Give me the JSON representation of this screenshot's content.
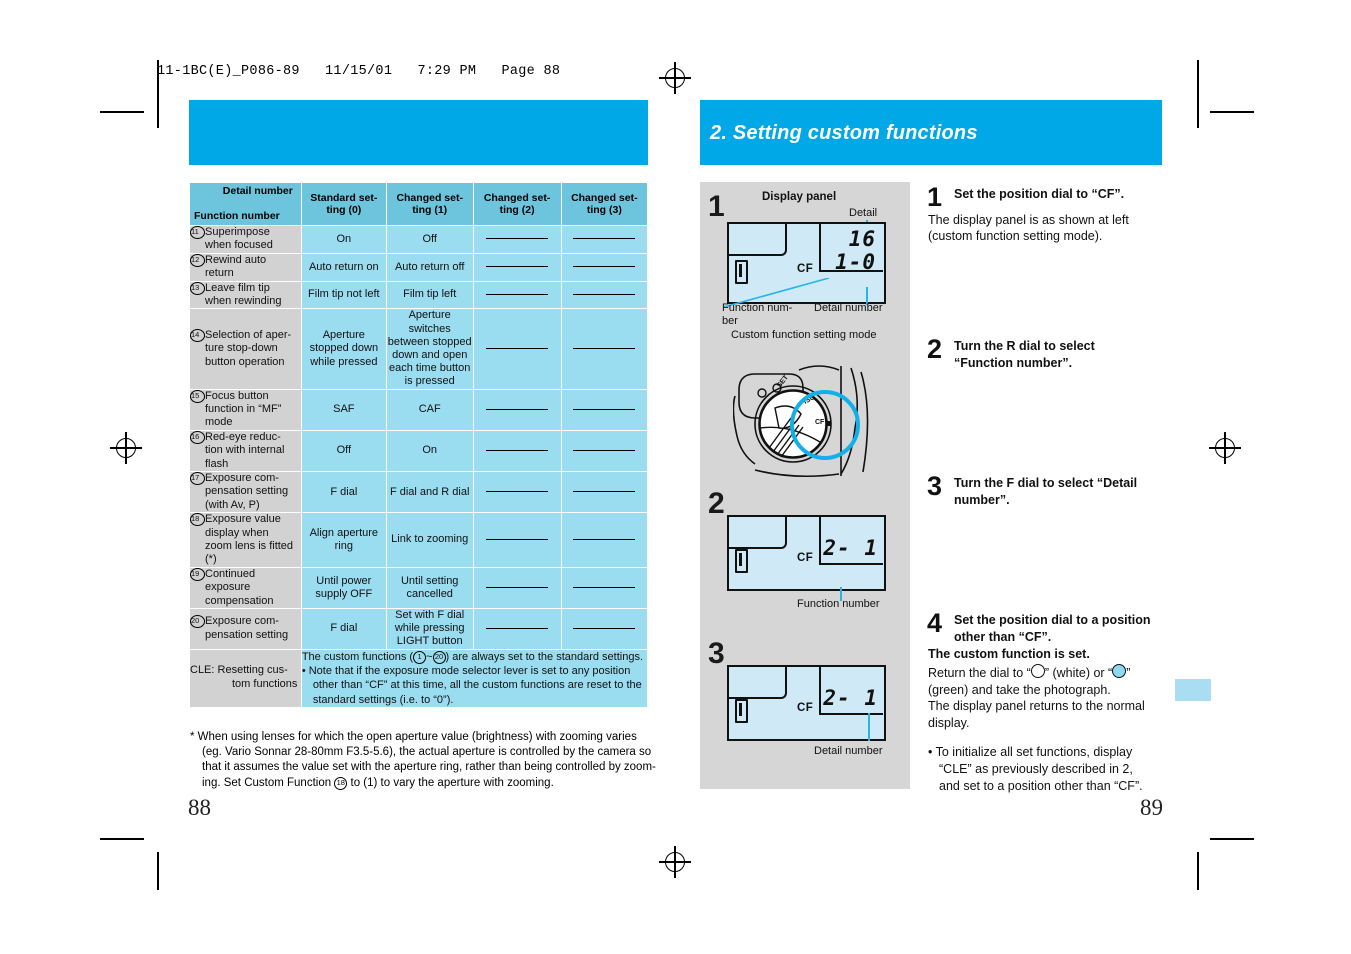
{
  "document": {
    "slug": "11-1BC(E)_P086-89   11/15/01   7:29 PM   Page 88",
    "section_title": "2. Setting custom functions",
    "page_left": "88",
    "page_right": "89",
    "accent_color": "#00a8e8",
    "table_header_color": "#6cc5dd",
    "table_value_color": "#9adcf0",
    "table_label_color": "#d2d2d2"
  },
  "table": {
    "corner": {
      "top_right_label": "Detail number",
      "bottom_left_label": "Function number"
    },
    "columns": [
      "Standard set-\nting (0)",
      "Changed set-\nting (1)",
      "Changed set-\nting (2)",
      "Changed set-\nting (3)"
    ],
    "columns_split": [
      {
        "l1": "Standard set-",
        "l2": "ting (0)"
      },
      {
        "l1": "Changed set-",
        "l2": "ting (1)"
      },
      {
        "l1": "Changed set-",
        "l2": "ting (2)"
      },
      {
        "l1": "Changed set-",
        "l2": "ting (3)"
      }
    ],
    "rows": [
      {
        "num": "11",
        "name": "Superimpose when focused",
        "c0": "On",
        "c1": "Off",
        "c2": "",
        "c3": ""
      },
      {
        "num": "12",
        "name": "Rewind auto return",
        "c0": "Auto return on",
        "c1": "Auto return off",
        "c2": "",
        "c3": ""
      },
      {
        "num": "13",
        "name": "Leave film tip when rewinding",
        "c0": "Film tip not left",
        "c1": "Film tip left",
        "c2": "",
        "c3": ""
      },
      {
        "num": "14",
        "name": "Selection of aper-ture stop-down button operation",
        "c0": "Aperture stopped down while pressed",
        "c1": "Aperture switches between stopped down and open each time button is pressed",
        "c2": "",
        "c3": ""
      },
      {
        "num": "15",
        "name": "Focus button function in “MF” mode",
        "c0": "SAF",
        "c1": "CAF",
        "c2": "",
        "c3": ""
      },
      {
        "num": "16",
        "name": "Red-eye reduc-tion with internal flash",
        "c0": "Off",
        "c1": "On",
        "c2": "",
        "c3": ""
      },
      {
        "num": "17",
        "name": "Exposure com-pensation setting (with Av, P)",
        "c0": "F dial",
        "c1": "F dial and R dial",
        "c2": "",
        "c3": ""
      },
      {
        "num": "18",
        "name": "Exposure value display when zoom lens is fitted (*)",
        "c0": "Align aperture ring",
        "c1": "Link to zooming",
        "c2": "",
        "c3": ""
      },
      {
        "num": "19",
        "name": "Continued exposure compensation",
        "c0": "Until power supply OFF",
        "c1": "Until setting cancelled",
        "c2": "",
        "c3": ""
      },
      {
        "num": "20",
        "name": "Exposure com-pensation setting",
        "c0": "F dial",
        "c1": "Set with F dial while pressing LIGHT button",
        "c2": "",
        "c3": ""
      }
    ],
    "cle_row": {
      "label_line1": "CLE: Resetting cus-",
      "label_line2": "tom functions",
      "text_line1_a": "The custom functions (",
      "text_line1_num1": "1",
      "text_line1_mid": "~",
      "text_line1_num2": "20",
      "text_line1_b": ") are always set to the standard settings.",
      "bullet": "Note that if the exposure mode selector lever is set to any position other than “CF” at this time, all the custom functions are reset to the standard settings (i.e. to “0”)."
    }
  },
  "footnote": {
    "line1": "* When using lenses for which the open aperture value (brightness) with zooming varies",
    "line2": "(eg. Vario Sonnar 28-80mm F3.5-5.6), the actual aperture is controlled by the camera so",
    "line3": "that it assumes the value set with the aperture ring, rather than being controlled by zoom-",
    "line4_a": "ing. Set Custom Function ",
    "line4_num": "18",
    "line4_b": " to (1) to vary the aperture with zooming."
  },
  "illustrations": {
    "panel1": {
      "step": "1",
      "title": "Display panel",
      "label_detail": "Detail",
      "label_function_number_l1": "Function num-",
      "label_function_number_l2": "ber",
      "label_detail_number": "Detail number",
      "caption": "Custom function setting mode",
      "lcd_cf": "CF",
      "lcd_top": "16",
      "lcd_bottom": "1-0"
    },
    "camera": {
      "dial_marks": [
        "SET",
        "ISO",
        "CF"
      ],
      "dial_circles": [
        "white-circle",
        "green-circle"
      ]
    },
    "panel2": {
      "step": "2",
      "lcd_cf": "CF",
      "lcd_value": "2- 1",
      "label": "Function number"
    },
    "panel3": {
      "step": "3",
      "lcd_cf": "CF",
      "lcd_value": "2- 1",
      "label": "Detail number"
    }
  },
  "instructions": [
    {
      "num": "1",
      "heading": "Set the position dial to “CF”.",
      "body_l1": "The display panel is as shown at left",
      "body_l2": "(custom function setting mode)."
    },
    {
      "num": "2",
      "heading_l1": "Turn the R dial to select",
      "heading_l2": "“Function number”."
    },
    {
      "num": "3",
      "heading_l1": " Turn the F dial to select “Detail",
      "heading_l2": "number”."
    },
    {
      "num": "4",
      "heading_l1": "Set the position dial to a position",
      "heading_l2": "other than “CF”.",
      "heading_l3": "The custom function is set.",
      "body_a": "Return the dial to “",
      "body_b": "” (white) or “",
      "body_c": "”",
      "body_l2": "(green) and take the photograph.",
      "body_l3": "The display panel returns to the normal",
      "body_l4": "display.",
      "bullet_l1": "To initialize all set functions, display",
      "bullet_l2": "“CLE” as previously described in 2,",
      "bullet_l3": "and set to a position other than “CF”."
    }
  ]
}
